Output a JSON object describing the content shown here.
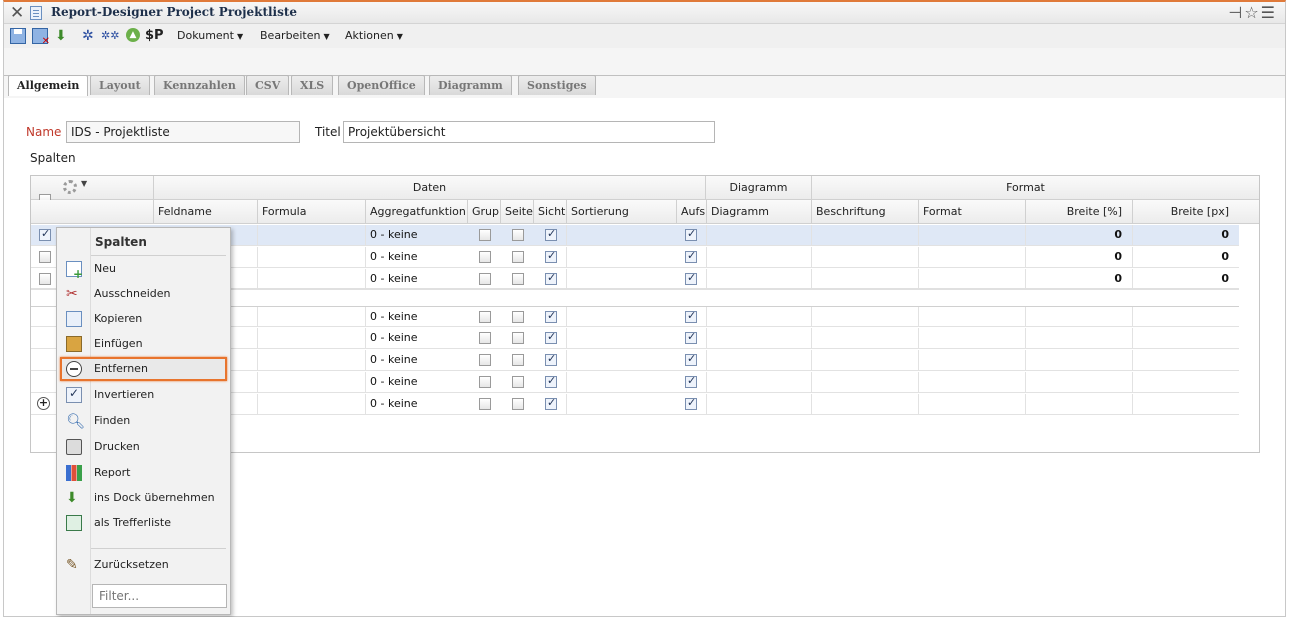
{
  "window": {
    "title": "Report-Designer Project Projektliste"
  },
  "toolbar": {
    "sp_label": "$P",
    "menus": [
      "Dokument",
      "Bearbeiten",
      "Aktionen"
    ]
  },
  "tabs": [
    "Allgemein",
    "Layout",
    "Kennzahlen",
    "CSV",
    "XLS",
    "OpenOffice",
    "Diagramm",
    "Sonstiges"
  ],
  "form": {
    "name_label": "Name",
    "name_value": "IDS - Projektliste",
    "titel_label": "Titel",
    "titel_value": "Projektübersicht",
    "spalten_label": "Spalten"
  },
  "grid": {
    "groups": {
      "daten": "Daten",
      "diagramm": "Diagramm",
      "format": "Format"
    },
    "columns": {
      "feldname": "Feldname",
      "formula": "Formula",
      "aggregat": "Aggregatfunktion",
      "grup": "Grup",
      "seite": "Seite",
      "sicht": "Sicht",
      "sortierung": "Sortierung",
      "aufs": "Aufs",
      "diagramm": "Diagramm",
      "beschriftung": "Beschriftung",
      "format": "Format",
      "breite_pct": "Breite [%]",
      "breite_px": "Breite [px]"
    },
    "rows": [
      {
        "aggregat": "0 - keine",
        "breite_pct": "0",
        "breite_px": "0"
      },
      {
        "aggregat": "0 - keine",
        "breite_pct": "0",
        "breite_px": "0"
      },
      {
        "aggregat": "0 - keine",
        "breite_pct": "0",
        "breite_px": "0"
      },
      {
        "aggregat": "0 - keine",
        "breite_pct": "",
        "breite_px": ""
      },
      {
        "aggregat": "0 - keine",
        "breite_pct": "",
        "breite_px": ""
      },
      {
        "aggregat": "0 - keine",
        "breite_pct": "",
        "breite_px": ""
      },
      {
        "aggregat": "0 - keine",
        "breite_pct": "",
        "breite_px": ""
      },
      {
        "aggregat": "0 - keine",
        "breite_pct": "",
        "breite_px": ""
      }
    ]
  },
  "context_menu": {
    "title": "Spalten",
    "items": [
      {
        "label": "Neu",
        "icon": "new-icon"
      },
      {
        "label": "Ausschneiden",
        "icon": "cut-icon"
      },
      {
        "label": "Kopieren",
        "icon": "copy-icon"
      },
      {
        "label": "Einfügen",
        "icon": "paste-icon"
      },
      {
        "label": "Entfernen",
        "icon": "remove-icon"
      },
      {
        "label": "Invertieren",
        "icon": "invert-icon"
      },
      {
        "label": "Finden",
        "icon": "find-icon"
      },
      {
        "label": "Drucken",
        "icon": "print-icon"
      },
      {
        "label": "Report",
        "icon": "report-icon"
      },
      {
        "label": "ins Dock übernehmen",
        "icon": "dock-icon"
      },
      {
        "label": "als Trefferliste",
        "icon": "hitlist-icon"
      },
      {
        "label": "Zurücksetzen",
        "icon": "reset-icon"
      }
    ],
    "filter_placeholder": "Filter..."
  },
  "colors": {
    "accent": "#e8742d",
    "name_label": "#c0392b",
    "selected_row": "#dfe8f6"
  }
}
